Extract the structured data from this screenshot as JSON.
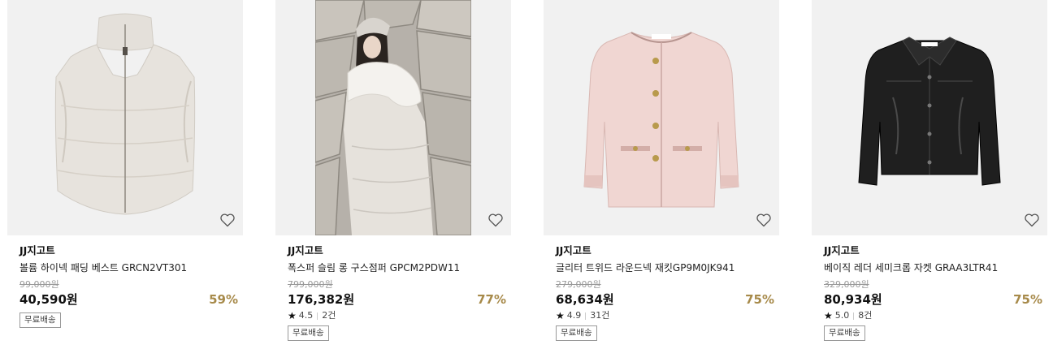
{
  "colors": {
    "discount": "#a78a4a",
    "thumb_background": "#f1f1f1",
    "original_price": "#999999"
  },
  "products": [
    {
      "brand": "JJ지고트",
      "name": "볼륨 하이넥 패딩 베스트 GRCN2VT301",
      "original_price": "99,000원",
      "price": "40,590원",
      "discount": "59%",
      "rating": null,
      "review_count": null,
      "badge": "무료배송",
      "image": "cream-padded-vest",
      "wishlist_icon": "heart-outline-icon"
    },
    {
      "brand": "JJ지고트",
      "name": "폭스퍼 슬림 롱 구스점퍼 GPCM2PDW11",
      "original_price": "799,000원",
      "price": "176,382원",
      "discount": "77%",
      "rating": "4.5",
      "review_count": "2건",
      "badge": "무료배송",
      "image": "model-in-long-fur-hood-puffer",
      "wishlist_icon": "heart-outline-icon"
    },
    {
      "brand": "JJ지고트",
      "name": "글리터 트위드 라운드넥 재킷GP9M0JK941",
      "original_price": "279,000원",
      "price": "68,634원",
      "discount": "75%",
      "rating": "4.9",
      "review_count": "31건",
      "badge": "무료배송",
      "image": "pink-tweed-jacket",
      "wishlist_icon": "heart-outline-icon"
    },
    {
      "brand": "JJ지고트",
      "name": "베이직 레더 세미크롭 자켓 GRAA3LTR41",
      "original_price": "329,000원",
      "price": "80,934원",
      "discount": "75%",
      "rating": "5.0",
      "review_count": "8건",
      "badge": "무료배송",
      "image": "black-leather-jacket",
      "wishlist_icon": "heart-outline-icon"
    }
  ]
}
